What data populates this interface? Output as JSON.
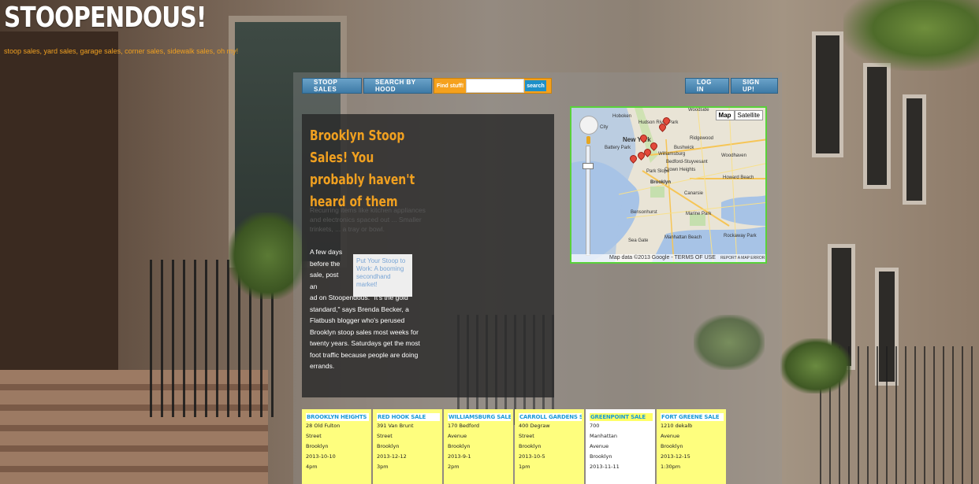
{
  "site": {
    "title": "STOOPENDOUS!",
    "tagline": "stoop sales, yard sales, garage sales, corner sales, sidewalk sales, oh my!"
  },
  "nav": {
    "stoop_sales": "STOOP SALES",
    "search_by_hood": "SEARCH BY HOOD",
    "find_label": "Find stuff!",
    "search_value": "",
    "search_button": "search",
    "log_in": "LOG IN",
    "sign_up": "SIGN UP!"
  },
  "card": {
    "title": "Brooklyn Stoop Sales! You probably haven't heard of them",
    "ghost_text": "Recurring items like kitchen appliances and electronics spaced out ... Smaller trinkets, ... a tray or bowl.",
    "pull_quote": "Put Your Stoop to Work: A booming secondhand market!",
    "lead": "A few days before the sale, post an",
    "body": "ad on Stoopendous. \"It's the gold standard,\" says Brenda Becker, a Flatbush blogger who's perused Brooklyn stoop sales most weeks for twenty years. Saturdays get the most foot traffic because people are doing errands."
  },
  "map": {
    "type_map": "Map",
    "type_satellite": "Satellite",
    "attribution": "Map data ©2013 Google - TERMS OF USE",
    "report": "REPORT A MAP ERROR",
    "labels": [
      "Woodside",
      "Hoboken",
      "Hudson River Park",
      "City",
      "New York",
      "Ridgewood",
      "Battery Park",
      "Bushwick",
      "Williamsburg",
      "Woodhaven",
      "Bedford-Stuyvesant",
      "Park Slope",
      "Crown Heights",
      "Brooklyn",
      "Canarsie",
      "Howard Beach",
      "Bensonhurst",
      "Marine Park",
      "Rockaway Park",
      "Sea Gate",
      "Manhattan Beach"
    ],
    "pins": 7
  },
  "sales": [
    {
      "name": "BROOKLYN HEIGHTS SALE",
      "lines": [
        "28 Old Fulton",
        "Street",
        "Brooklyn",
        "2013-10-10",
        "4pm"
      ],
      "style": "yellow"
    },
    {
      "name": "RED HOOK SALE",
      "lines": [
        "391 Van Brunt",
        "Street",
        "Brooklyn",
        "2013-12-12",
        "3pm"
      ],
      "style": "yellow"
    },
    {
      "name": "WILLIAMSBURG SALE",
      "lines": [
        "170 Bedford",
        "Avenue",
        "Brooklyn",
        "2013-9-1",
        "2pm"
      ],
      "style": "yellow"
    },
    {
      "name": "CARROLL GARDENS SALE",
      "lines": [
        "400 Degraw",
        "Street",
        "Brooklyn",
        "2013-10-5",
        "1pm"
      ],
      "style": "yellow"
    },
    {
      "name": "GREENPOINT SALE",
      "lines": [
        "700",
        "Manhattan",
        "Avenue",
        "Brooklyn",
        "2013-11-11"
      ],
      "style": "white"
    },
    {
      "name": "FORT GREENE SALE",
      "lines": [
        "1210 dekalb",
        "Avenue",
        "Brooklyn",
        "2013-12-15",
        "1:30pm"
      ],
      "style": "yellow"
    }
  ]
}
